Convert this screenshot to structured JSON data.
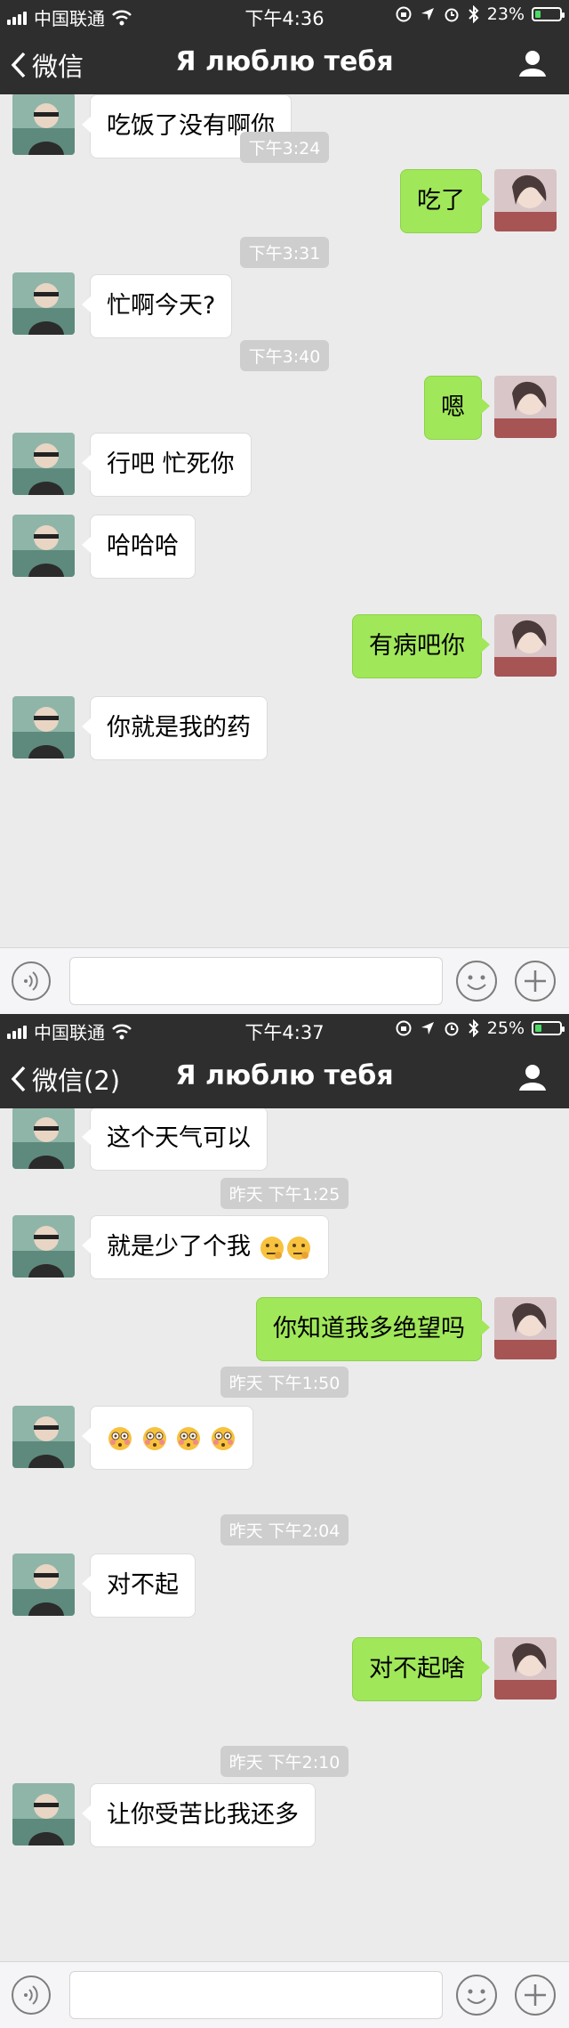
{
  "screens": [
    {
      "status": {
        "carrier": "中国联通",
        "time": "下午4:36",
        "battery": "23%",
        "battery_level": 0.23
      },
      "nav": {
        "back_label": "微信",
        "title": "Я люблю тебя"
      },
      "messages": [
        {
          "type": "text",
          "side": "peer",
          "text": "吃饭了没有啊你"
        },
        {
          "type": "time",
          "text": "下午3:24"
        },
        {
          "type": "text",
          "side": "me",
          "text": "吃了"
        },
        {
          "type": "time",
          "text": "下午3:31"
        },
        {
          "type": "text",
          "side": "peer",
          "text": "忙啊今天?"
        },
        {
          "type": "time",
          "text": "下午3:40"
        },
        {
          "type": "text",
          "side": "me",
          "text": "嗯"
        },
        {
          "type": "text",
          "side": "peer",
          "text": "行吧 忙死你"
        },
        {
          "type": "text",
          "side": "peer",
          "text": "哈哈哈"
        },
        {
          "type": "text",
          "side": "me",
          "text": "有病吧你"
        },
        {
          "type": "text",
          "side": "peer",
          "text": "你就是我的药"
        }
      ]
    },
    {
      "status": {
        "carrier": "中国联通",
        "time": "下午4:37",
        "battery": "25%",
        "battery_level": 0.25
      },
      "nav": {
        "back_label": "微信(2)",
        "title": "Я люблю тебя"
      },
      "messages": [
        {
          "type": "text",
          "side": "peer",
          "text": "这个天气可以"
        },
        {
          "type": "time",
          "text": "昨天 下午1:25"
        },
        {
          "type": "text",
          "side": "peer",
          "text": "就是少了个我",
          "emoji": [
            "thinking-face",
            "thinking-face"
          ]
        },
        {
          "type": "text",
          "side": "me",
          "text": "你知道我多绝望吗"
        },
        {
          "type": "time",
          "text": "昨天 下午1:50"
        },
        {
          "type": "emoji-only",
          "side": "peer",
          "emoji": [
            "flushed-face",
            "flushed-face",
            "flushed-face",
            "flushed-face"
          ]
        },
        {
          "type": "time",
          "text": "昨天 下午2:04"
        },
        {
          "type": "text",
          "side": "peer",
          "text": "对不起"
        },
        {
          "type": "text",
          "side": "me",
          "text": "对不起啥"
        },
        {
          "type": "time",
          "text": "昨天 下午2:10"
        },
        {
          "type": "text",
          "side": "peer",
          "text": "让你受苦比我还多"
        }
      ]
    }
  ],
  "colors": {
    "nav_bg": "#2e2e2e",
    "chat_bg": "#ebebeb",
    "my_bubble": "#a0e75a",
    "peer_bubble": "#ffffff",
    "timestamp_bg": "#cecece"
  },
  "icons": [
    "signal-icon",
    "wifi-icon",
    "lock-rotation-icon",
    "location-icon",
    "alarm-icon",
    "bluetooth-icon",
    "battery-icon",
    "back-chevron-icon",
    "profile-icon",
    "voice-icon",
    "emoji-icon",
    "plus-icon"
  ]
}
